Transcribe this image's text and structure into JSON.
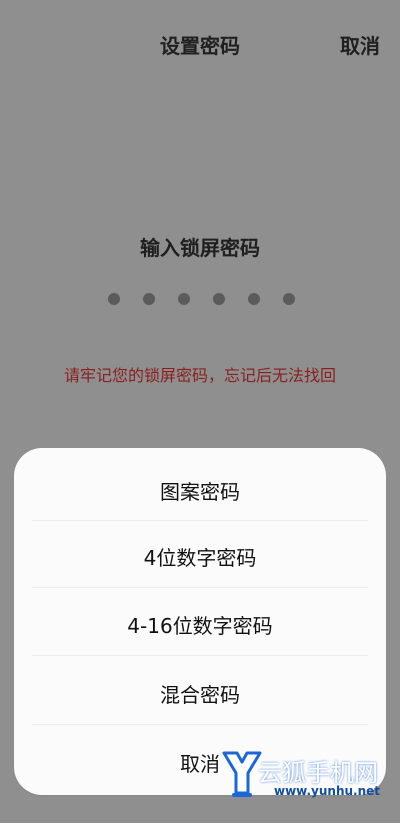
{
  "header": {
    "title": "设置密码",
    "cancel": "取消"
  },
  "lock_screen": {
    "prompt": "输入锁屏密码",
    "dot_count": 6,
    "warning": "请牢记您的锁屏密码，忘记后无法找回"
  },
  "password_type_sheet": {
    "options": [
      "图案密码",
      "4位数字密码",
      "4-16位数字密码",
      "混合密码",
      "取消"
    ]
  },
  "watermark": {
    "title": "云狐手机网",
    "url": "www.yunhu.net"
  },
  "colors": {
    "background": "#8f8f8f",
    "sheet": "#fbfbfb",
    "warning": "#8b1f1f",
    "watermark_blue": "#1b67d8"
  }
}
